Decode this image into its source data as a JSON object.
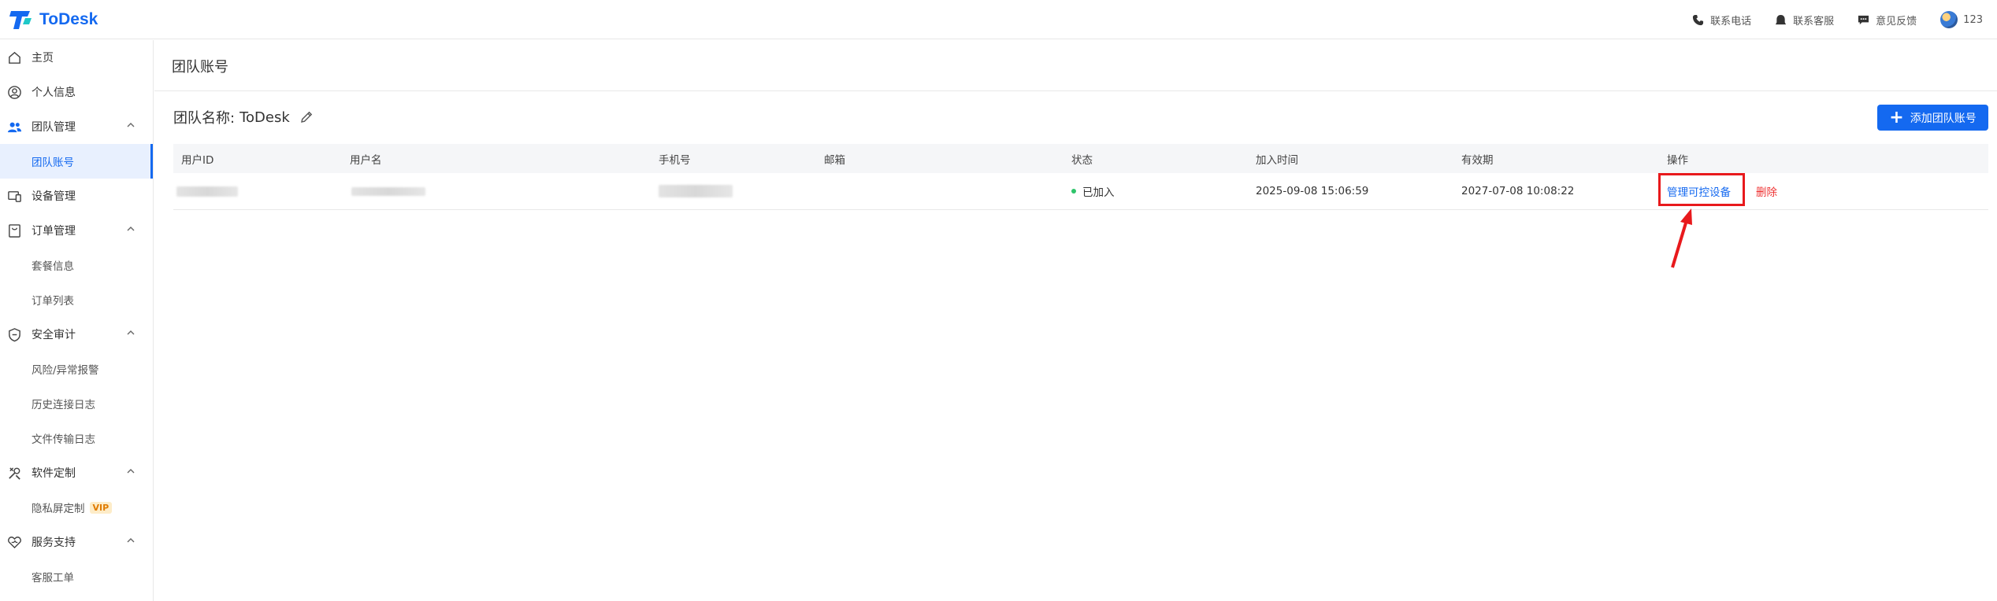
{
  "app": {
    "brand": "ToDesk"
  },
  "topbar": {
    "phone": "联系电话",
    "service": "联系客服",
    "feedback": "意见反馈",
    "user": "123"
  },
  "sidebar": {
    "items": [
      {
        "label": "主页",
        "icon": "home-icon"
      },
      {
        "label": "个人信息",
        "icon": "user-circle-icon"
      },
      {
        "label": "团队管理",
        "icon": "team-icon",
        "expanded": true
      },
      {
        "label": "团队账号",
        "sub": true,
        "active": true
      },
      {
        "label": "设备管理",
        "icon": "devices-icon"
      },
      {
        "label": "订单管理",
        "icon": "order-icon",
        "expanded": true
      },
      {
        "label": "套餐信息",
        "sub": true
      },
      {
        "label": "订单列表",
        "sub": true
      },
      {
        "label": "安全审计",
        "icon": "shield-icon",
        "expanded": true
      },
      {
        "label": "风险/异常报警",
        "sub": true
      },
      {
        "label": "历史连接日志",
        "sub": true
      },
      {
        "label": "文件传输日志",
        "sub": true
      },
      {
        "label": "软件定制",
        "icon": "tools-icon",
        "expanded": true
      },
      {
        "label": "隐私屏定制",
        "sub": true,
        "badge": "VIP"
      },
      {
        "label": "服务支持",
        "icon": "support-icon",
        "expanded": true
      },
      {
        "label": "客服工单",
        "sub": true
      }
    ]
  },
  "page": {
    "title": "团队账号",
    "team_label": "团队名称:",
    "team_name": "ToDesk",
    "add_button": "添加团队账号"
  },
  "table": {
    "columns": [
      "用户ID",
      "用户名",
      "手机号",
      "邮箱",
      "状态",
      "加入时间",
      "有效期",
      "操作"
    ],
    "rows": [
      {
        "status": "已加入",
        "joined": "2025-09-08 15:06:59",
        "expires": "2027-07-08 10:08:22",
        "action_manage": "管理可控设备",
        "action_delete": "删除"
      }
    ]
  },
  "colors": {
    "accent": "#1469f0",
    "danger": "#e33333",
    "success": "#2ec46a",
    "highlight": "#e8191c"
  }
}
